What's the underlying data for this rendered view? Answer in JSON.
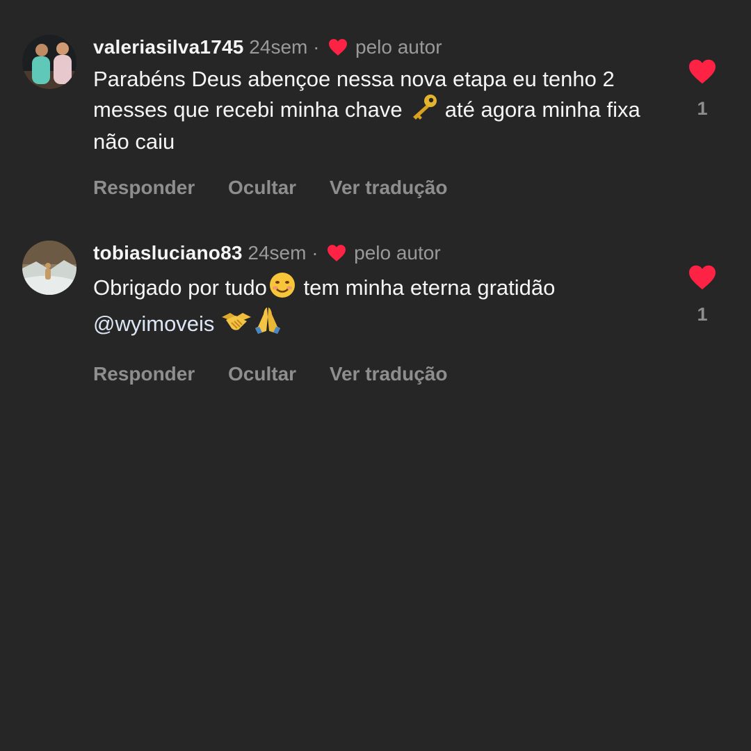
{
  "colors": {
    "background": "#262626",
    "heart": "#fe2244",
    "muted": "#9a9a9a"
  },
  "comments": [
    {
      "username": "valeriasilva1745",
      "time": "24sem",
      "separator": "·",
      "author_label": "pelo autor",
      "text_parts": [
        "Parabéns Deus abençoe nessa nova etapa eu tenho 2 messes que recebi minha chave ",
        " até agora minha fixa não caiu"
      ],
      "emojis": [
        "key-icon"
      ],
      "actions": [
        "Responder",
        "Ocultar",
        "Ver tradução"
      ],
      "like_count": "1"
    },
    {
      "username": "tobiasluciano83",
      "time": "24sem",
      "separator": "·",
      "author_label": "pelo autor",
      "text_parts": [
        "Obrigado por tudo",
        " tem minha eterna gratidão "
      ],
      "mention": "@wyimoveis",
      "emojis": [
        "smiling-face-icon",
        "handshake-icon",
        "praying-hands-icon"
      ],
      "actions": [
        "Responder",
        "Ocultar",
        "Ver tradução"
      ],
      "like_count": "1"
    }
  ]
}
